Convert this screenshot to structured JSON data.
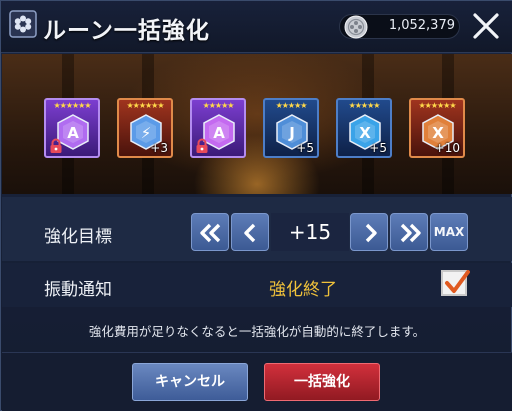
{
  "header": {
    "title": "ルーン一括強化",
    "currency_value": "1,052,379",
    "title_icon": "rune-flower-icon",
    "currency_icon": "silver-coin-icon",
    "close_icon": "close-icon"
  },
  "runes": [
    {
      "stars": "★★★★★★",
      "level": "",
      "frame": "purple",
      "locked": true,
      "gem_color": "#b06cf0",
      "glyph": "A"
    },
    {
      "stars": "★★★★★★",
      "level": "+3",
      "frame": "red",
      "locked": false,
      "gem_color": "#5b9be8",
      "glyph": "⚡"
    },
    {
      "stars": "★★★★★",
      "level": "",
      "frame": "purple",
      "locked": true,
      "gem_color": "#c46af0",
      "glyph": "A"
    },
    {
      "stars": "★★★★★",
      "level": "+5",
      "frame": "blue",
      "locked": false,
      "gem_color": "#4f8ed8",
      "glyph": "J"
    },
    {
      "stars": "★★★★★",
      "level": "+5",
      "frame": "blue",
      "locked": false,
      "gem_color": "#3aa3e8",
      "glyph": "X"
    },
    {
      "stars": "★★★★★★",
      "level": "+10",
      "frame": "red",
      "locked": false,
      "gem_color": "#e0803a",
      "glyph": "X"
    }
  ],
  "target": {
    "label": "強化目標",
    "value": "+15",
    "max_label": "MAX"
  },
  "notify": {
    "label": "振動通知",
    "status": "強化終了",
    "checked": true
  },
  "notice": "強化費用が足りなくなると一括強化が自動的に終了します。",
  "buttons": {
    "cancel": "キャンセル",
    "confirm": "一括強化"
  },
  "colors": {
    "accent_gold": "#f0c23a",
    "confirm_red": "#d2303c",
    "button_blue": "#5d7cb8",
    "check_orange": "#e05a20"
  }
}
